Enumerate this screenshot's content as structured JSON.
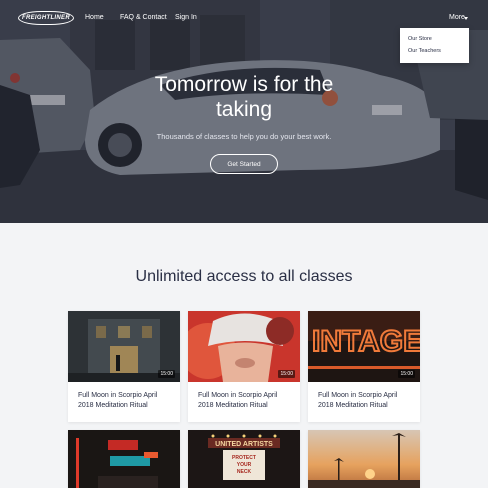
{
  "nav": {
    "logo_text": "FREIGHTLINER",
    "links": [
      "Home",
      "FAQ & Contact",
      "Sign In"
    ],
    "more_label": "More",
    "dropdown": [
      "Our Store",
      "Our Teachers"
    ]
  },
  "hero": {
    "headline_line1": "Tomorrow is for the",
    "headline_line2": "taking",
    "subtitle": "Thousands of classes to help you do your best work.",
    "cta_label": "Get Started"
  },
  "section": {
    "title": "Unlimited access to all classes"
  },
  "cards": [
    {
      "title_line1": "Full Moon in Scorpio April",
      "title_line2": "2018 Meditation Ritual",
      "duration": "15:00",
      "image": "building-night"
    },
    {
      "title_line1": "Full Moon in Scorpio April",
      "title_line2": "2018 Meditation Ritual",
      "duration": "15:00",
      "image": "vr-headset"
    },
    {
      "title_line1": "Full Moon in Scorpio April",
      "title_line2": "2018 Meditation Ritual",
      "duration": "15:00",
      "image": "neon-vintage-sign"
    },
    {
      "image": "neon-street-night"
    },
    {
      "image": "theater-marquee"
    },
    {
      "image": "palm-sunset"
    }
  ],
  "colors": {
    "text_dark": "#2a2f45",
    "page_bg": "#f3f4f6"
  }
}
